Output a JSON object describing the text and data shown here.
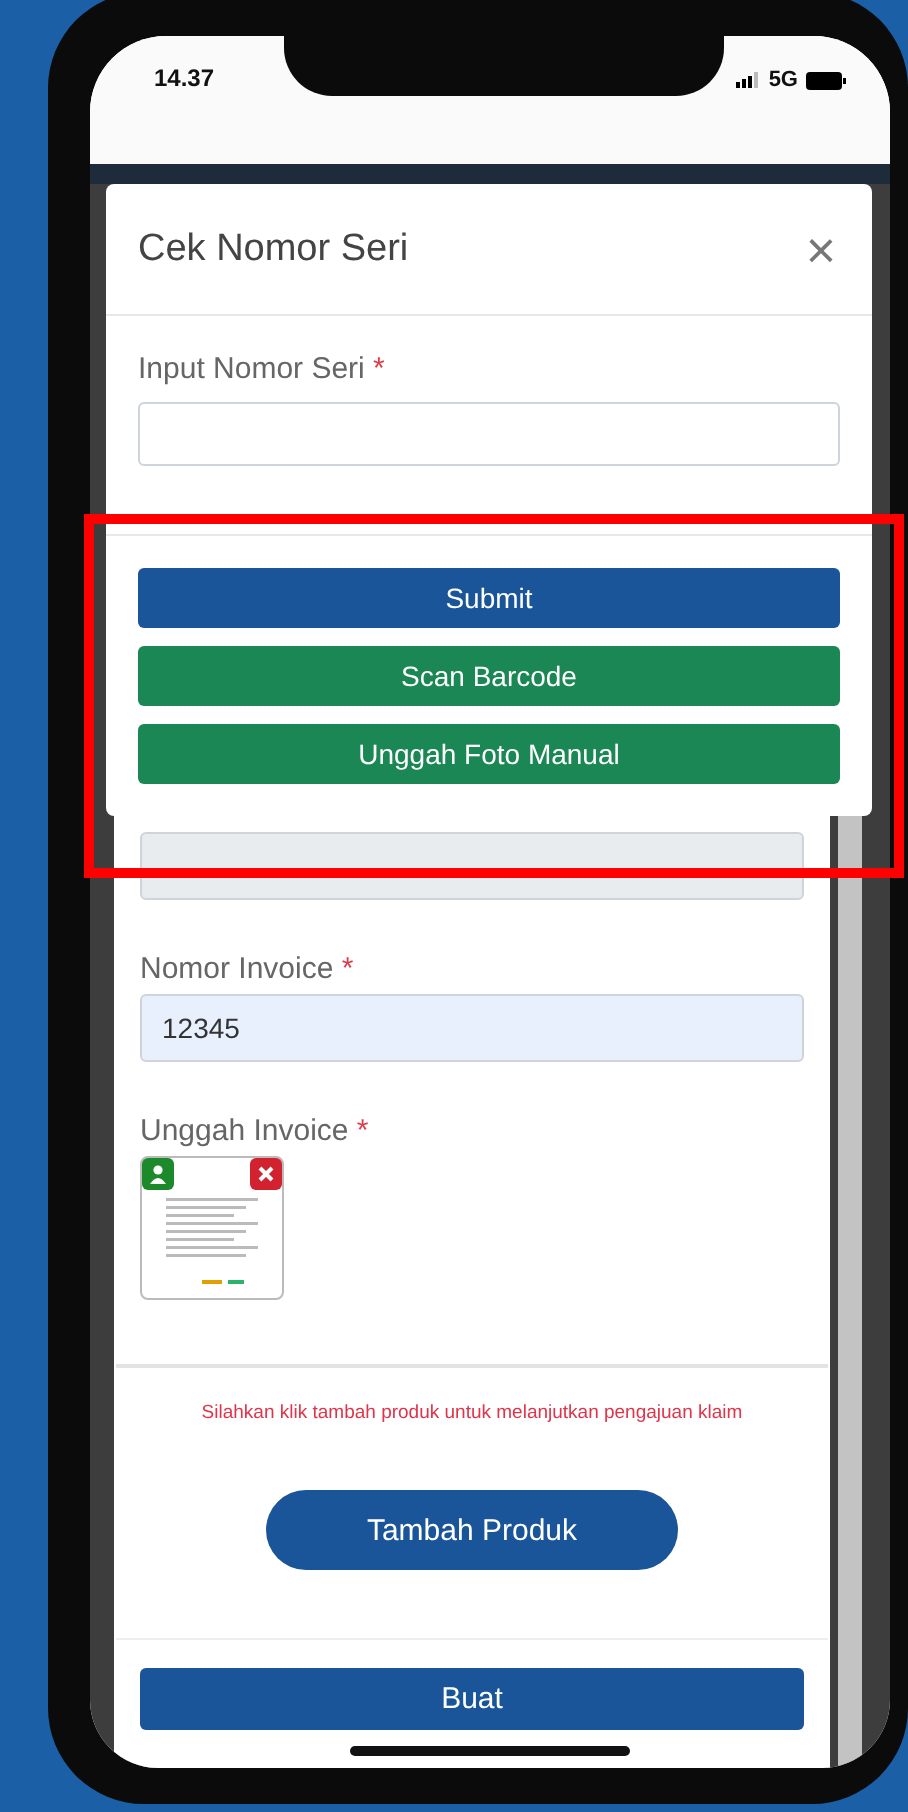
{
  "status_bar": {
    "time": "14.37",
    "network": "5G"
  },
  "form": {
    "date_field": {
      "disabled": true
    },
    "invoice_number": {
      "label": "Nomor Invoice",
      "required_mark": "*",
      "value": "12345"
    },
    "invoice_upload": {
      "label": "Unggah Invoice",
      "required_mark": "*"
    },
    "notice": "Silahkan klik tambah produk untuk melanjutkan pengajuan klaim",
    "add_button": "Tambah Produk",
    "submit_button": "Buat"
  },
  "modal": {
    "title": "Cek Nomor Seri",
    "close": "×",
    "field": {
      "label": "Input Nomor Seri",
      "required_mark": "*"
    },
    "buttons": [
      {
        "label": "Submit",
        "kind": "primary"
      },
      {
        "label": "Scan Barcode",
        "kind": "success"
      },
      {
        "label": "Unggah Foto Manual",
        "kind": "success"
      }
    ]
  },
  "highlight": {
    "shown": true
  }
}
